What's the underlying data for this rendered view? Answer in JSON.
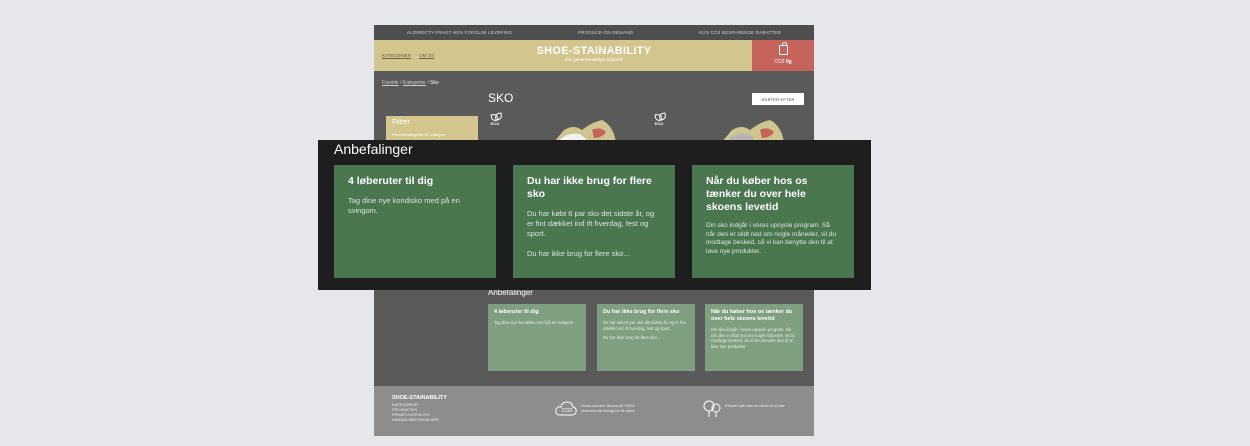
{
  "topbar": {
    "items": [
      "ALDIRECTY FRAGT HEN FORGLIM LEVERING",
      "PRODUCE-ON-DEMAND",
      "KUN CO2 BESPARENDE RABATTER"
    ]
  },
  "header": {
    "nav": [
      "KATEGORIER",
      "OM OS"
    ],
    "logo": "SHOE-STAINABILITY",
    "tagline": "Din genanvendelige skobutik",
    "cart_label": "CO2",
    "cart_value": "0g"
  },
  "breadcrumb": {
    "home": "Forside",
    "category": "Kategorier",
    "current": "Sko"
  },
  "page_title": "SKO",
  "sort_button": "SORTER EFTER",
  "filter": {
    "title": "Filtrer",
    "line": "Produktkategorier Pr. kategori"
  },
  "eco_label": "ECO",
  "recommendations": {
    "heading": "Anbefalinger",
    "cards": [
      {
        "title": "4 løberuter til dig",
        "body": [
          "Tag dine nye kondisko med på en svingom."
        ]
      },
      {
        "title": "Du har ikke brug for flere sko",
        "body": [
          "Du har købt 6 par sko det sidste år, og er fint dækket ind ift hverdag, fest og sport.",
          "Du har ikke brug for flere sko..."
        ]
      },
      {
        "title": "Når du køber hos os tænker du over hele skoens levetid",
        "body": [
          "Din sko indgår i vores upcycle program. Så når den er slidt ned om nogle måneder, vil du modtage besked, så vi kan benytte den til at lave nye produkter."
        ]
      }
    ]
  },
  "footer": {
    "brand": "SHOE-STAINABILITY",
    "links": [
      "KATEGORIER",
      "PRODUKTER",
      "PRIVATLIVSPOLITIK",
      "HANDELSBETINGELSER"
    ],
    "co2_text": "Vores servere drives på 100% vedvarende energi for at være",
    "tree_text": "Ethvert køb hos os bliver til et træ"
  },
  "colors": {
    "header": "#d3c58e",
    "cart": "#c6635b",
    "card_dark": "#4a7750",
    "card_light": "#809e80",
    "overlay": "#1d1e1d"
  }
}
